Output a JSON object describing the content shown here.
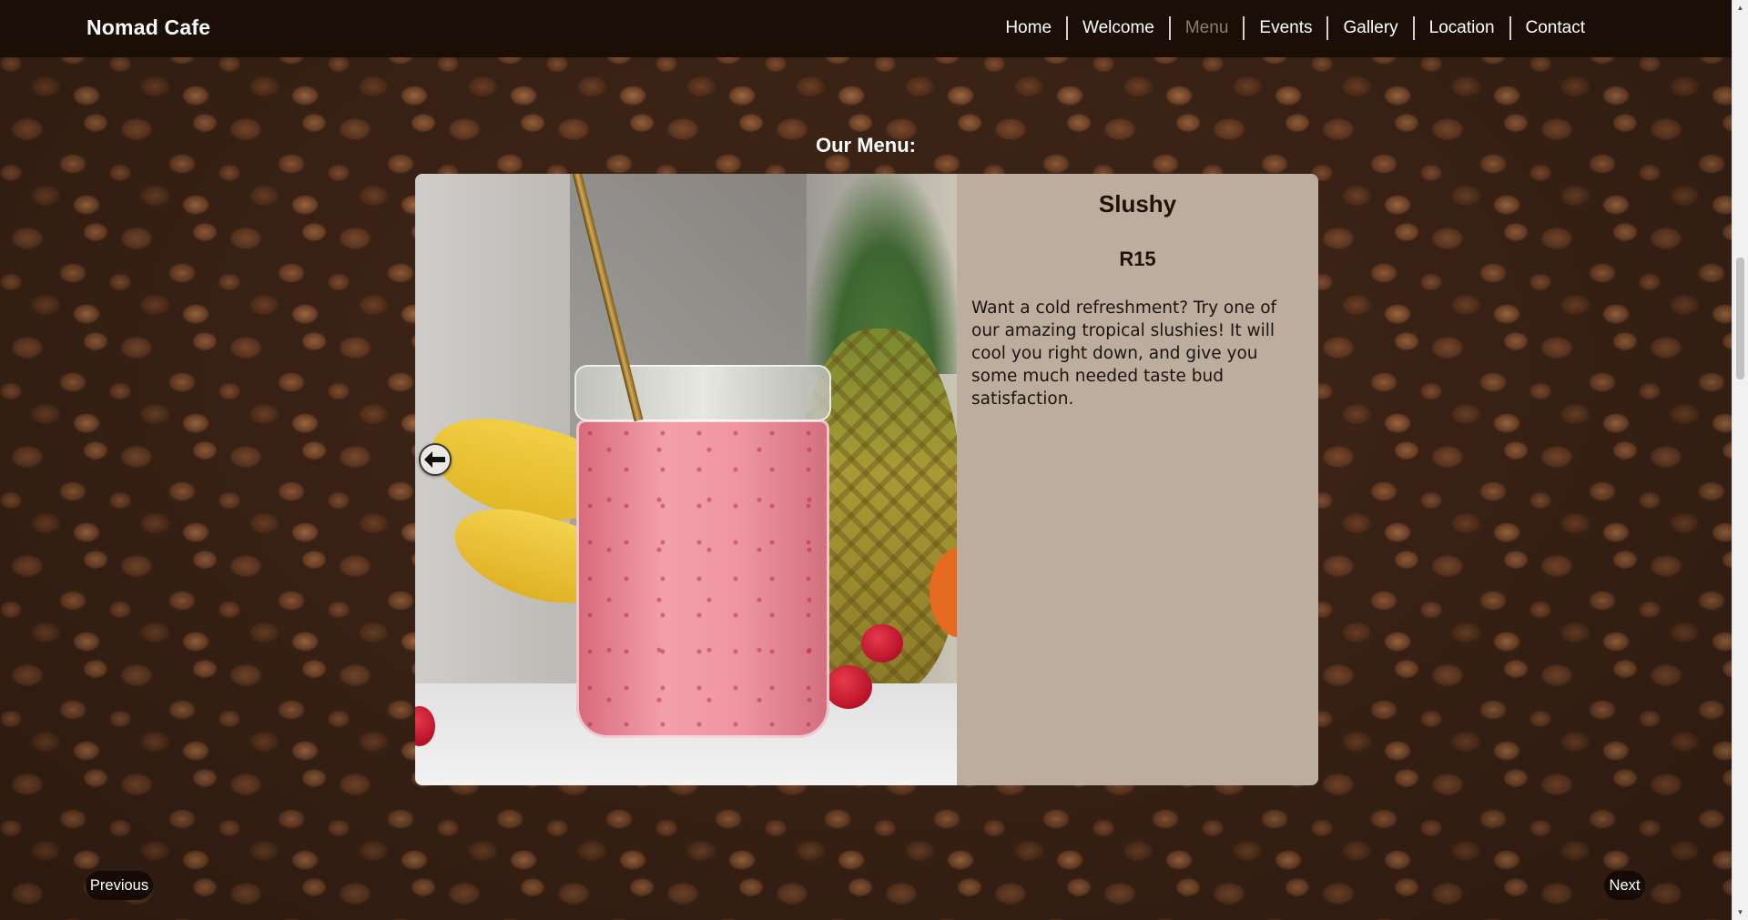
{
  "brand": "Nomad Cafe",
  "nav": {
    "items": [
      {
        "label": "Home",
        "active": false
      },
      {
        "label": "Welcome",
        "active": false
      },
      {
        "label": "Menu",
        "active": true
      },
      {
        "label": "Events",
        "active": false
      },
      {
        "label": "Gallery",
        "active": false
      },
      {
        "label": "Location",
        "active": false
      },
      {
        "label": "Contact",
        "active": false
      }
    ]
  },
  "menu": {
    "heading": "Our Menu:",
    "item": {
      "name": "Slushy",
      "price": "R15",
      "description": "Want a cold refreshment? Try one of our amazing tropical slushies! It will cool you right down, and give you some much needed taste bud satisfaction.",
      "image_icon": "slushy-photo"
    }
  },
  "pagination": {
    "previous_label": "Previous",
    "next_label": "Next"
  },
  "colors": {
    "navbar": "#1b0e06",
    "nav_active": "#8f7d70",
    "card_info": "#bdad9e",
    "pill": "#150a05"
  },
  "icons": {
    "carousel_prev": "arrow-left-icon"
  }
}
